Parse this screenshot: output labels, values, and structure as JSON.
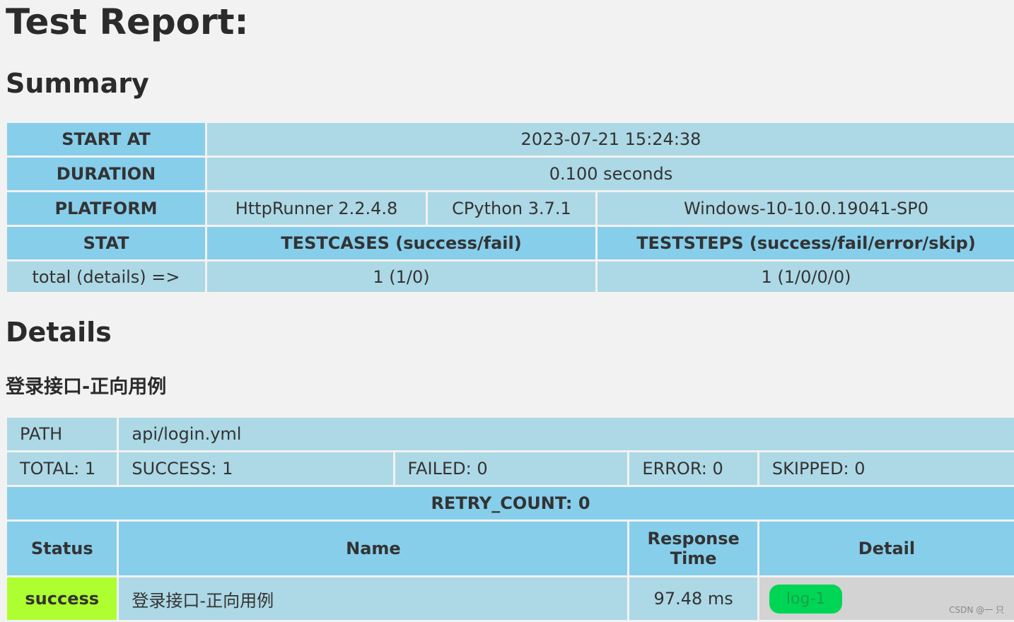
{
  "title": "Test Report:",
  "summary_heading": "Summary",
  "summary": {
    "start_at_label": "START AT",
    "start_at_value": "2023-07-21 15:24:38",
    "duration_label": "DURATION",
    "duration_value": "0.100 seconds",
    "platform_label": "PLATFORM",
    "platform_runner": "HttpRunner 2.2.4.8",
    "platform_python": "CPython 3.7.1",
    "platform_os": "Windows-10-10.0.19041-SP0",
    "stat_label": "STAT",
    "testcases_header": "TESTCASES (success/fail)",
    "teststeps_header": "TESTSTEPS (success/fail/error/skip)",
    "total_label": "total (details) =>",
    "testcases_value": "1 (1/0)",
    "teststeps_value": "1 (1/0/0/0)"
  },
  "details_heading": "Details",
  "testcase": {
    "name": "登录接口-正向用例",
    "path_label": "PATH",
    "path_value": "api/login.yml",
    "total": "TOTAL: 1",
    "success": "SUCCESS: 1",
    "failed": "FAILED: 0",
    "error": "ERROR: 0",
    "skipped": "SKIPPED: 0",
    "retry_count": "RETRY_COUNT: 0",
    "columns": {
      "status": "Status",
      "name": "Name",
      "response_time": "Response Time",
      "detail": "Detail"
    },
    "records": [
      {
        "status": "success",
        "name": "登录接口-正向用例",
        "response_time": "97.48 ms",
        "log_button": "log-1"
      }
    ]
  },
  "watermark": "CSDN @一 只",
  "colors": {
    "background": "#f2f2f2",
    "header_cell": "#87ceeb",
    "data_cell": "#add8e6",
    "success": "#adff2f",
    "log_button": "#00d555",
    "detail_cell": "#d3d3d3"
  }
}
